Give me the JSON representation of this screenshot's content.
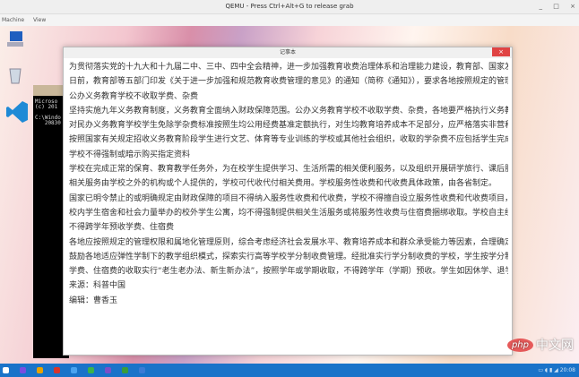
{
  "window": {
    "title": "QEMU - Press Ctrl+Alt+G to release grab",
    "minimize": "_",
    "maximize": "□",
    "close": "×"
  },
  "menu": [
    "Machine",
    "View"
  ],
  "console": {
    "lines": [
      "Microso",
      "(c) 201",
      "",
      "C:\\Windo",
      "   20830"
    ]
  },
  "notepad": {
    "title": "记事本",
    "close": "×",
    "lines": [
      "为贯彻落实党的十九大和十九届二中、三中、四中全会精神，进一步加强教育收费治理体系和治理能力建设，教育部、国家发展改革委、",
      "日前，教育部等五部门印发《关于进一步加强和规范教育收费管理的意见》的通知（简称《通知》），要求各地按照规定的管理权限全面",
      "公办义务教育学校不收取学费、杂费",
      "坚持实施九年义务教育制度，义务教育全面纳入财政保障范围。公办义务教育学校不收取学费、杂费，各地要严格执行义务教育法，巩固",
      "对民办义务教育学校学生免除学杂费标准按照生均公用经费基准定额执行，对生均教育培养成本不足部分，应严格落实非营利性法定要求",
      "按照国家有关规定招收义务教育阶段学生进行文艺、体育等专业训练的学校或其他社会组织，收取的学杂费不应包括学生完成九年义务教",
      "学校不得强制或暗示购买指定资料",
      "学校在完成正常的保育、教育教学任务外，为在校学生提供学习、生活所需的相关便利服务，以及组织开展研学旅行、课后服务、社会实",
      "相关服务由学校之外的机构或个人提供的，学校可代收代付相关费用。学校服务性收费和代收费具体政策，由各省制定。",
      "国家已明令禁止的或明确规定由财政保障的项目不得纳入服务性收费和代收费，学校不得擅自设立服务性收费和代收费项目，不得在代收",
      "校内学生宿舍和社会力量举办的校外学生公寓，均不得强制提供相关生活服务或将服务性收费与住宿费捆绑收取。学校自主经营的食堂向",
      "不得跨学年预收学费、住宿费",
      "各地应按照规定的管理权限和属地化管理原则，综合考虑经济社会发展水平、教育培养成本和群众承受能力等因素，合理确定公办学校学",
      "鼓励各地适应弹性学制下的教学组织模式，探索实行高等学校学分制收费管理。经批准实行学分制收费的学校，学生按学分制培养方案正",
      "学费、住宿费的收取实行“老生老办法、新生新办法”，按照学年或学期收取，不得跨学年（学期）预收。学生如因休学、退学、提前",
      "来源：科普中国",
      "编辑：曹香玉"
    ]
  },
  "taskbar": {
    "clock": "20:08",
    "icons": [
      "start-icon",
      "app-icon",
      "chrome-icon",
      "app-icon",
      "app-icon",
      "wechat-icon",
      "visual-studio-icon",
      "app-icon",
      "app-icon"
    ]
  },
  "watermark": {
    "logo": "php",
    "text": "中文网"
  }
}
